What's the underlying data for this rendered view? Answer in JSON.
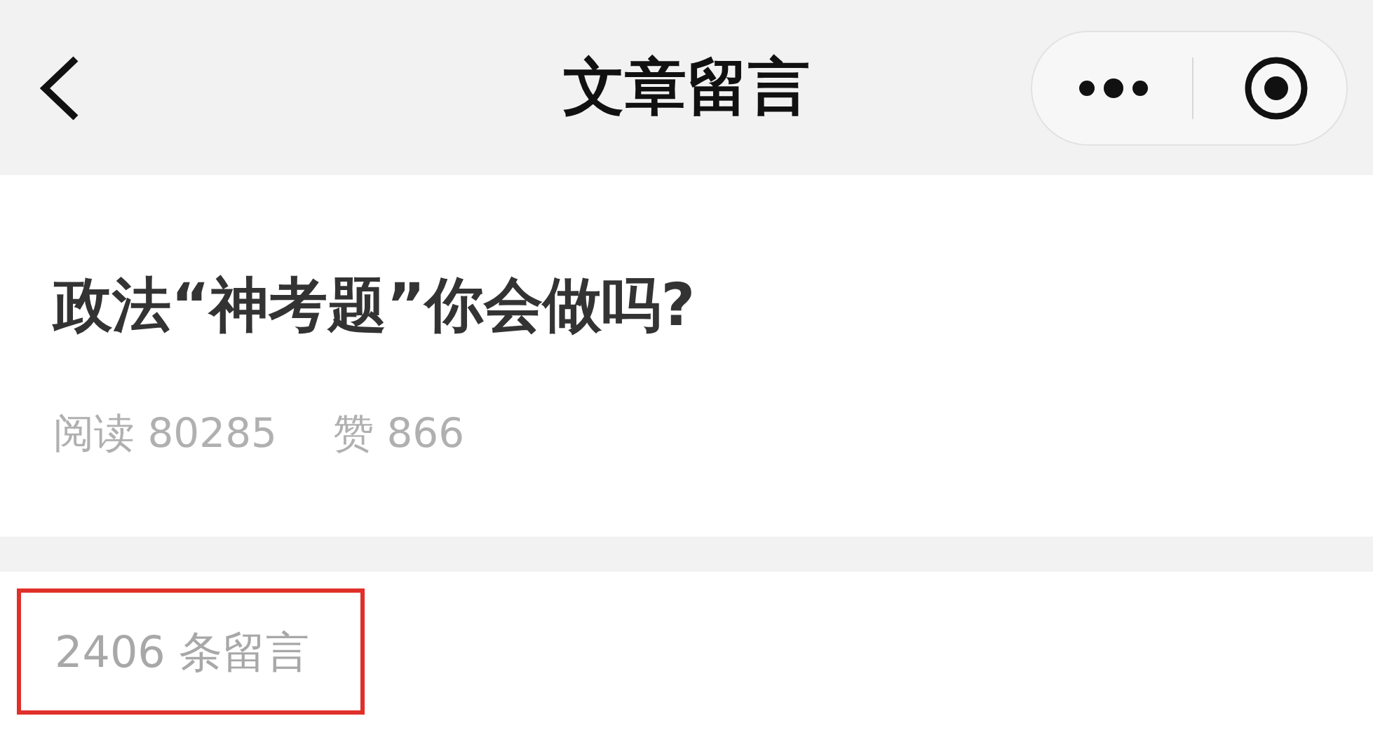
{
  "nav_bar": {
    "title": "文章留言"
  },
  "article": {
    "title": "政法“神考题”你会做吗?",
    "stats": [
      {
        "label": "阅读",
        "value": "80285"
      },
      {
        "label": "赞",
        "value": "866"
      }
    ]
  },
  "comments": {
    "count_text": "2406 条留言",
    "highlighted": true
  }
}
